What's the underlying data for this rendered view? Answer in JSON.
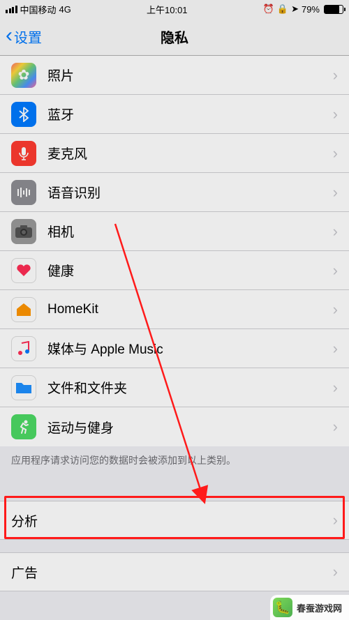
{
  "status": {
    "carrier": "中国移动",
    "network": "4G",
    "time": "上午10:01",
    "battery_pct": "79%"
  },
  "nav": {
    "back_label": "设置",
    "title": "隐私"
  },
  "rows": [
    {
      "label": "照片"
    },
    {
      "label": "蓝牙"
    },
    {
      "label": "麦克风"
    },
    {
      "label": "语音识别"
    },
    {
      "label": "相机"
    },
    {
      "label": "健康"
    },
    {
      "label": "HomeKit"
    },
    {
      "label": "媒体与 Apple Music"
    },
    {
      "label": "文件和文件夹"
    },
    {
      "label": "运动与健身"
    }
  ],
  "footer": "应用程序请求访问您的数据时会被添加到以上类别。",
  "section2": {
    "analytics": "分析",
    "ads": "广告"
  },
  "watermark": "春蚕游戏网"
}
